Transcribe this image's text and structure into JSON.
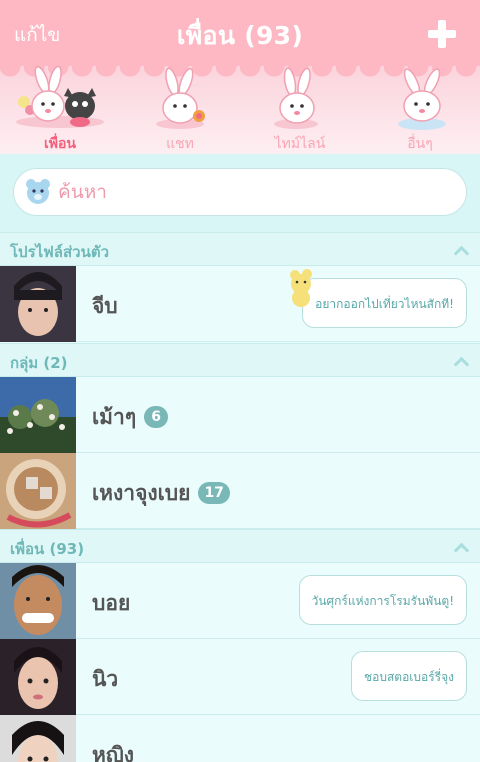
{
  "header": {
    "edit_label": "แก้ไข",
    "title": "เพื่อน (93)"
  },
  "tabs": [
    {
      "label": "เพื่อน",
      "active": true
    },
    {
      "label": "แชท",
      "active": false
    },
    {
      "label": "ไทม์ไลน์",
      "active": false
    },
    {
      "label": "อื่นๆ",
      "active": false
    }
  ],
  "search": {
    "placeholder": "ค้นหา"
  },
  "sections": {
    "profile": {
      "title": "โปรไฟล์ส่วนตัว"
    },
    "groups": {
      "title": "กลุ่ม (2)"
    },
    "friends": {
      "title": "เพื่อน (93)"
    }
  },
  "profile": {
    "name": "จีบ",
    "status": "อยากออกไปเที่ยวไหนสักที!"
  },
  "groups": [
    {
      "name": "เม้าๆ",
      "count": "6"
    },
    {
      "name": "เหงาจุงเบย",
      "count": "17"
    }
  ],
  "friends": [
    {
      "name": "บอย",
      "status": "วันศุกร์แห่งการโรมรันพันตู!"
    },
    {
      "name": "นิว",
      "status": "ชอบสตอเบอร์รี่จุง"
    },
    {
      "name": "หญิง",
      "status": ""
    }
  ],
  "colors": {
    "header": "#fdb8c4",
    "accent": "#f4607c",
    "teal": "#7ab7b7"
  }
}
